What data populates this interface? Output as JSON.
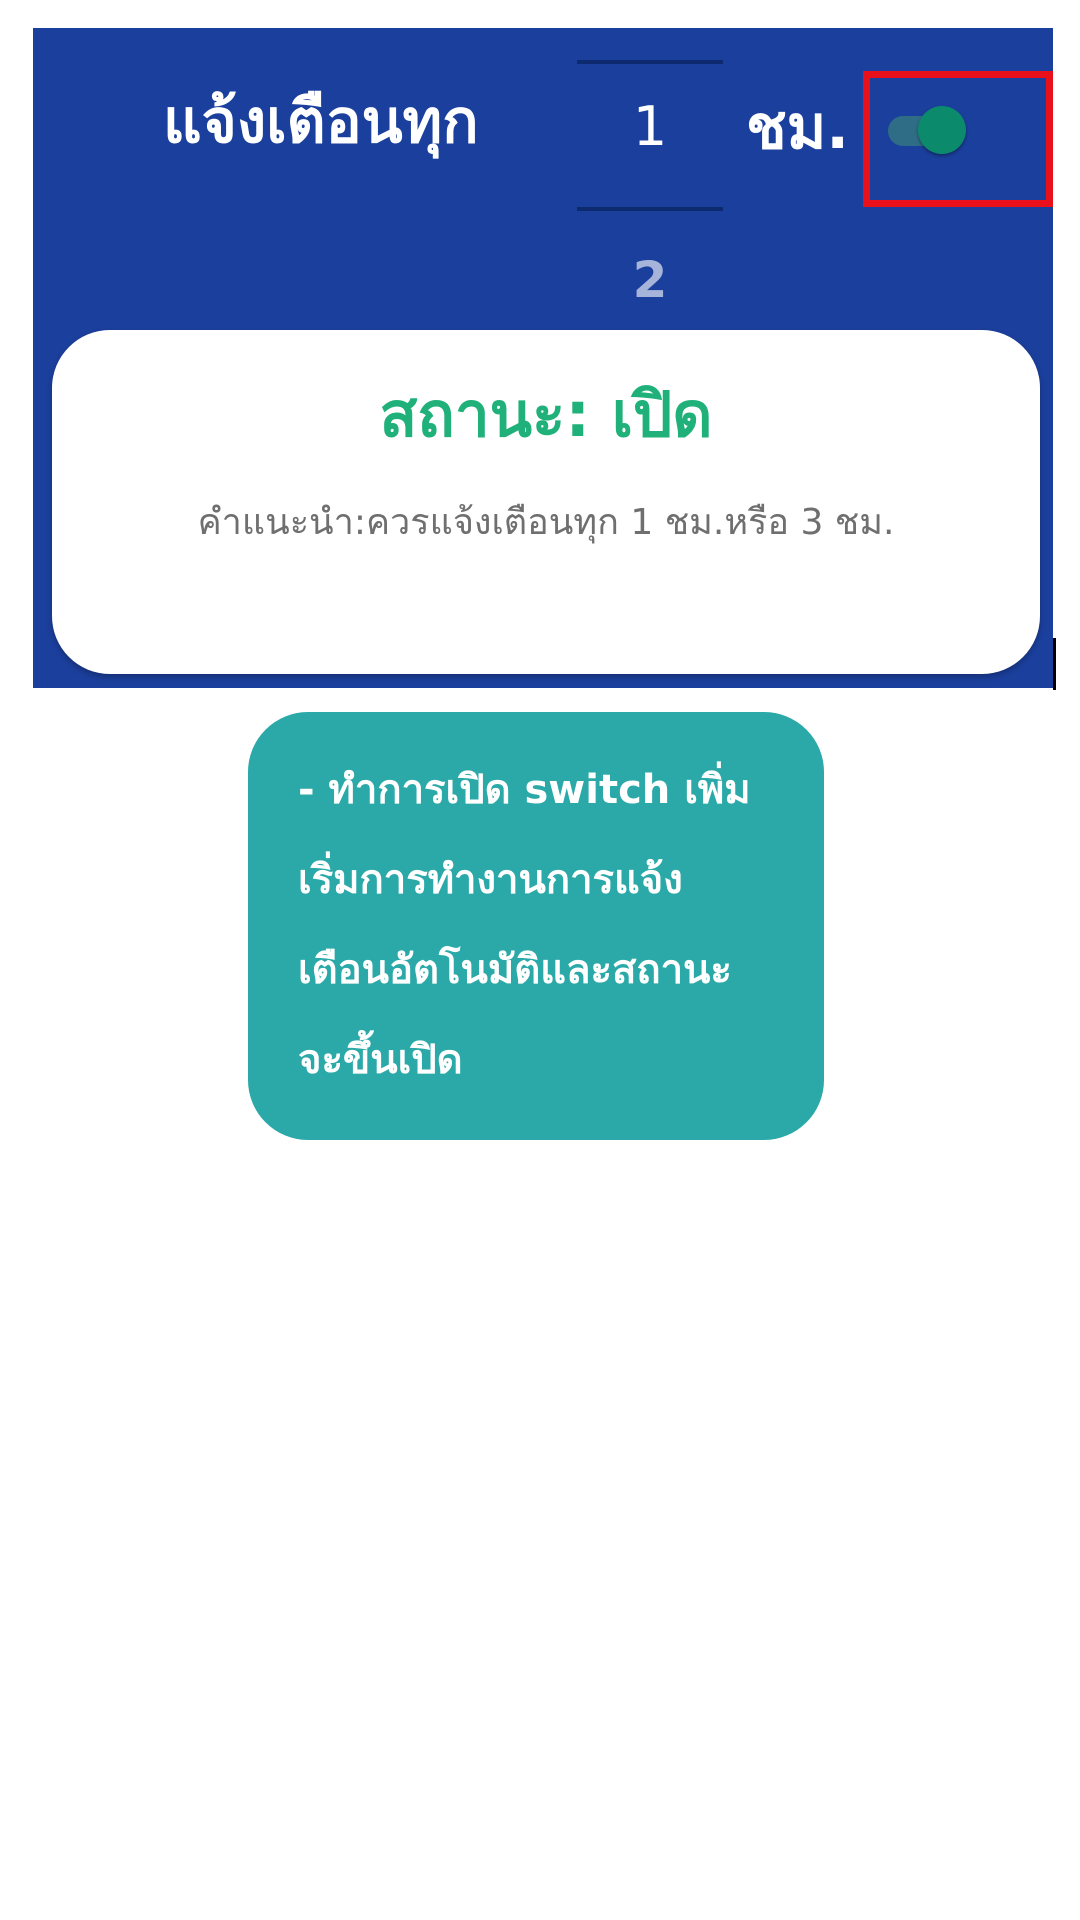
{
  "header": {
    "alert_label": "แจ้งเตือนทุก",
    "picker_selected": "1",
    "picker_next": "2",
    "unit_label": "ชม.",
    "toggle_on": true,
    "colors": {
      "panel_bg": "#1b3f9c",
      "toggle_thumb": "#0b8a6c",
      "highlight": "#e8111b"
    }
  },
  "status_card": {
    "title": "สถานะ: เปิด",
    "hint": "คำแนะนำ:ควรแจ้งเตือนทุก 1 ชม.หรือ 3 ชม.",
    "title_color": "#20b07a"
  },
  "tooltip": {
    "lines": [
      "- ทำการเปิด switch เพิ่ม",
      "เริ่มการทำงานการแจ้ง",
      "เตือนอัตโนมัติและสถานะ",
      "จะขึ้นเปิด"
    ],
    "bg_color": "#2aa9a8"
  }
}
